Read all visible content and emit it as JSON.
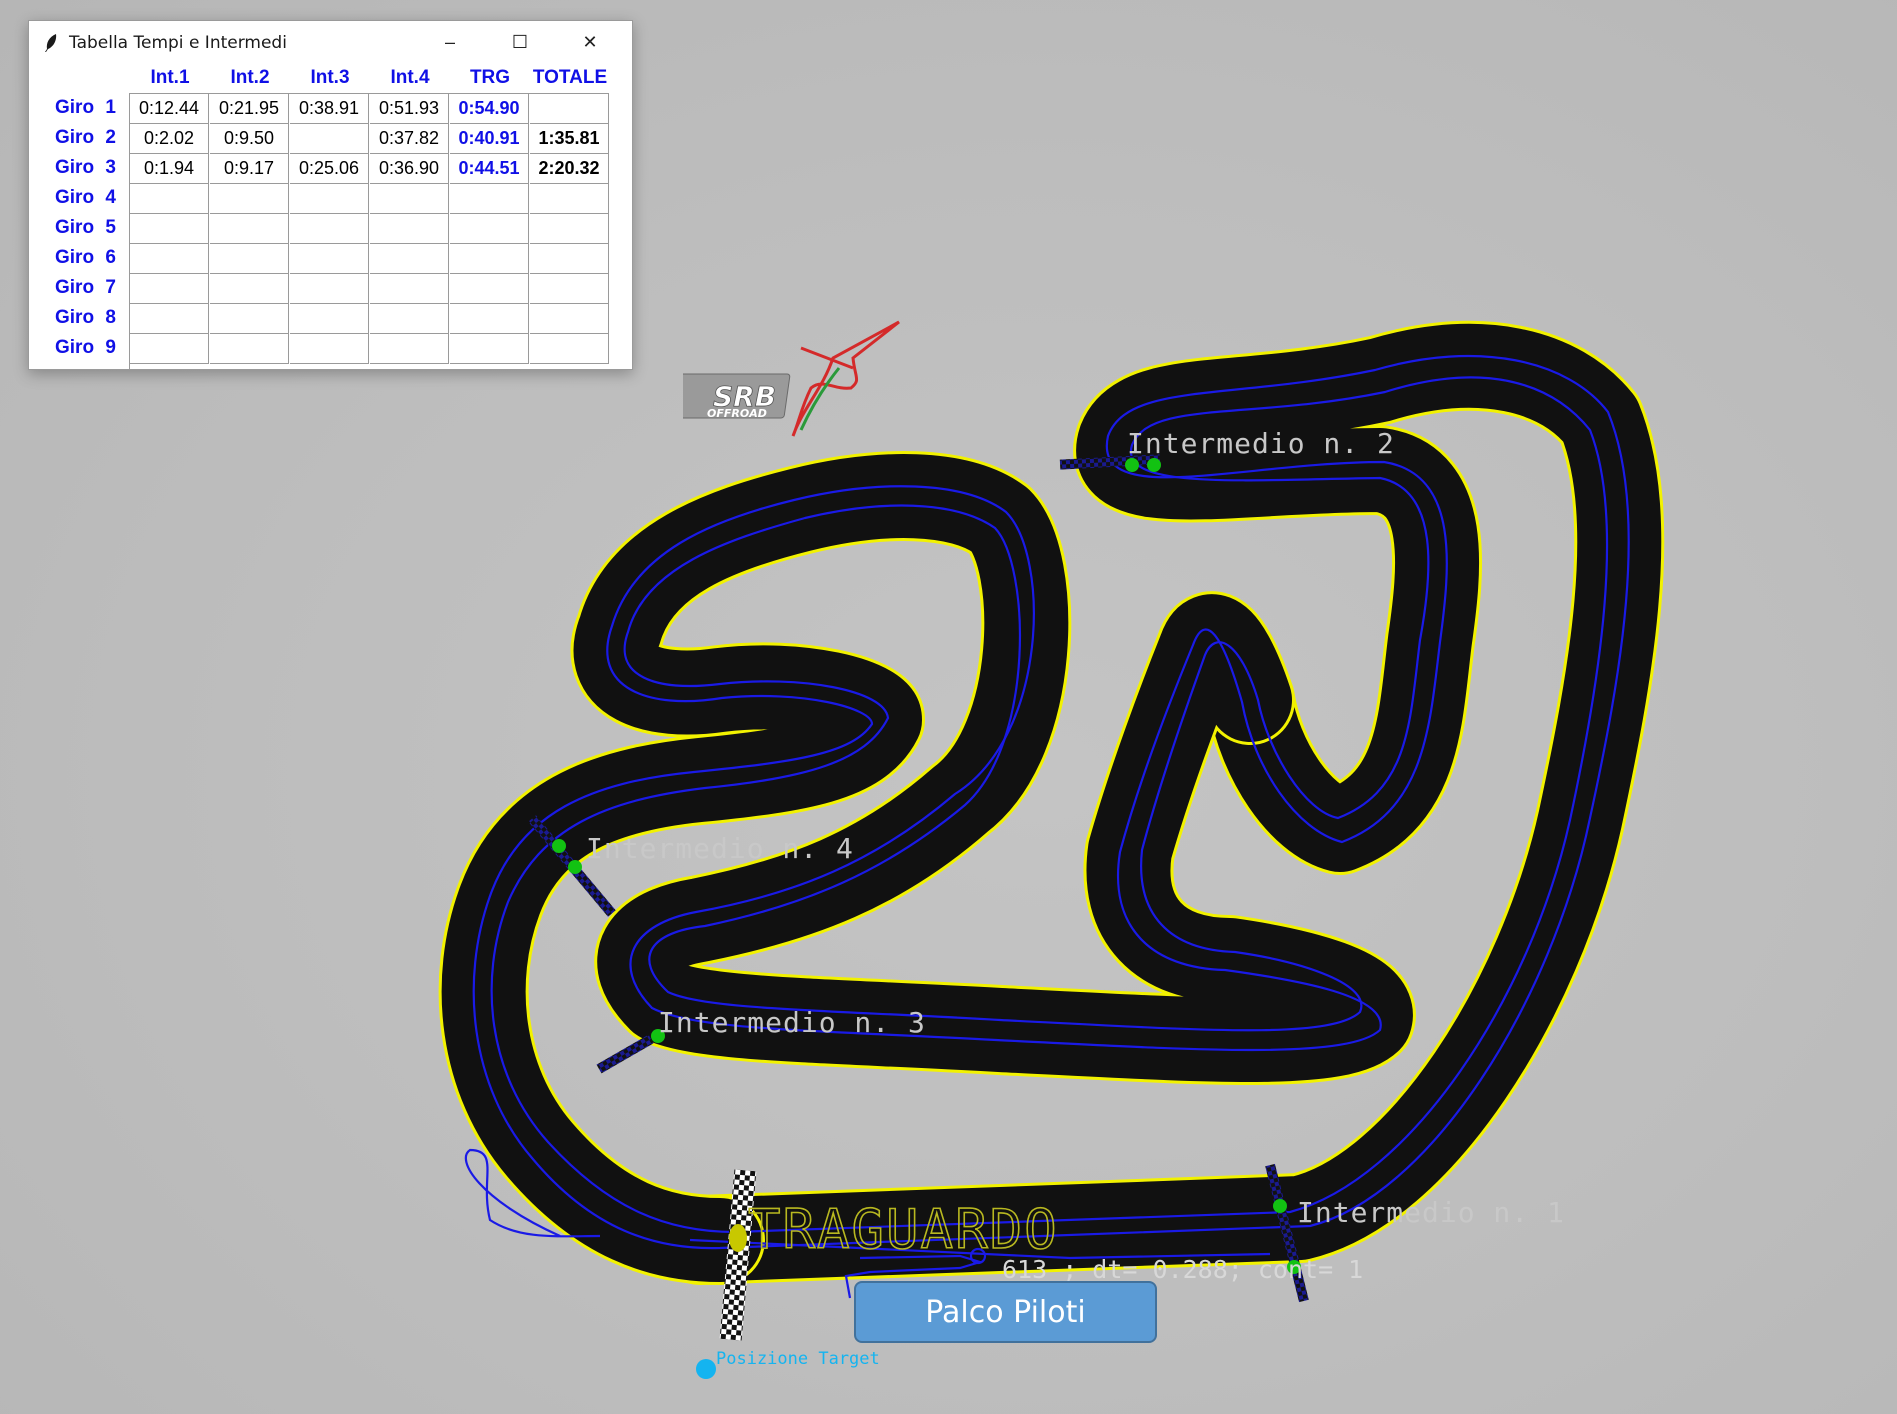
{
  "window": {
    "title": "Tabella Tempi e Intermedi",
    "controls": {
      "minimize": "–",
      "maximize": "☐",
      "close": "✕"
    }
  },
  "table": {
    "headers": [
      "Int.1",
      "Int.2",
      "Int.3",
      "Int.4",
      "TRG",
      "TOTALE"
    ],
    "rows": [
      {
        "label": "Giro 1",
        "cells": [
          "0:12.44",
          "0:21.95",
          "0:38.91",
          "0:51.93",
          "0:54.90",
          ""
        ]
      },
      {
        "label": "Giro 2",
        "cells": [
          "0:2.02",
          "0:9.50",
          "",
          "0:37.82",
          "0:40.91",
          "1:35.81"
        ]
      },
      {
        "label": "Giro 3",
        "cells": [
          "0:1.94",
          "0:9.17",
          "0:25.06",
          "0:36.90",
          "0:44.51",
          "2:20.32"
        ]
      },
      {
        "label": "Giro 4",
        "cells": [
          "",
          "",
          "",
          "",
          "",
          ""
        ]
      },
      {
        "label": "Giro 5",
        "cells": [
          "",
          "",
          "",
          "",
          "",
          ""
        ]
      },
      {
        "label": "Giro 6",
        "cells": [
          "",
          "",
          "",
          "",
          "",
          ""
        ]
      },
      {
        "label": "Giro 7",
        "cells": [
          "",
          "",
          "",
          "",
          "",
          ""
        ]
      },
      {
        "label": "Giro 8",
        "cells": [
          "",
          "",
          "",
          "",
          "",
          ""
        ]
      },
      {
        "label": "Giro 9",
        "cells": [
          "",
          "",
          "",
          "",
          "",
          ""
        ]
      }
    ]
  },
  "logo": {
    "text": "SRB",
    "subtext": "OFFROAD"
  },
  "track": {
    "labels": {
      "int1": "Intermedio n. 1",
      "int2": "Intermedio n. 2",
      "int3": "Intermedio n. 3",
      "int4": "Intermedio n. 4",
      "finish": "TRAGUARDO",
      "status": "613 ; dt= 0.288; cont= 1",
      "target": "Posizione Target"
    },
    "colors": {
      "track": "#111111",
      "edge": "#f2f200",
      "trajectory": "#1a1ae6",
      "marker": "#12c212",
      "target": "#14b4f0",
      "label": "#c8c8c8",
      "finish_label": "#b8b820"
    }
  },
  "palco": {
    "label": "Palco Piloti"
  }
}
